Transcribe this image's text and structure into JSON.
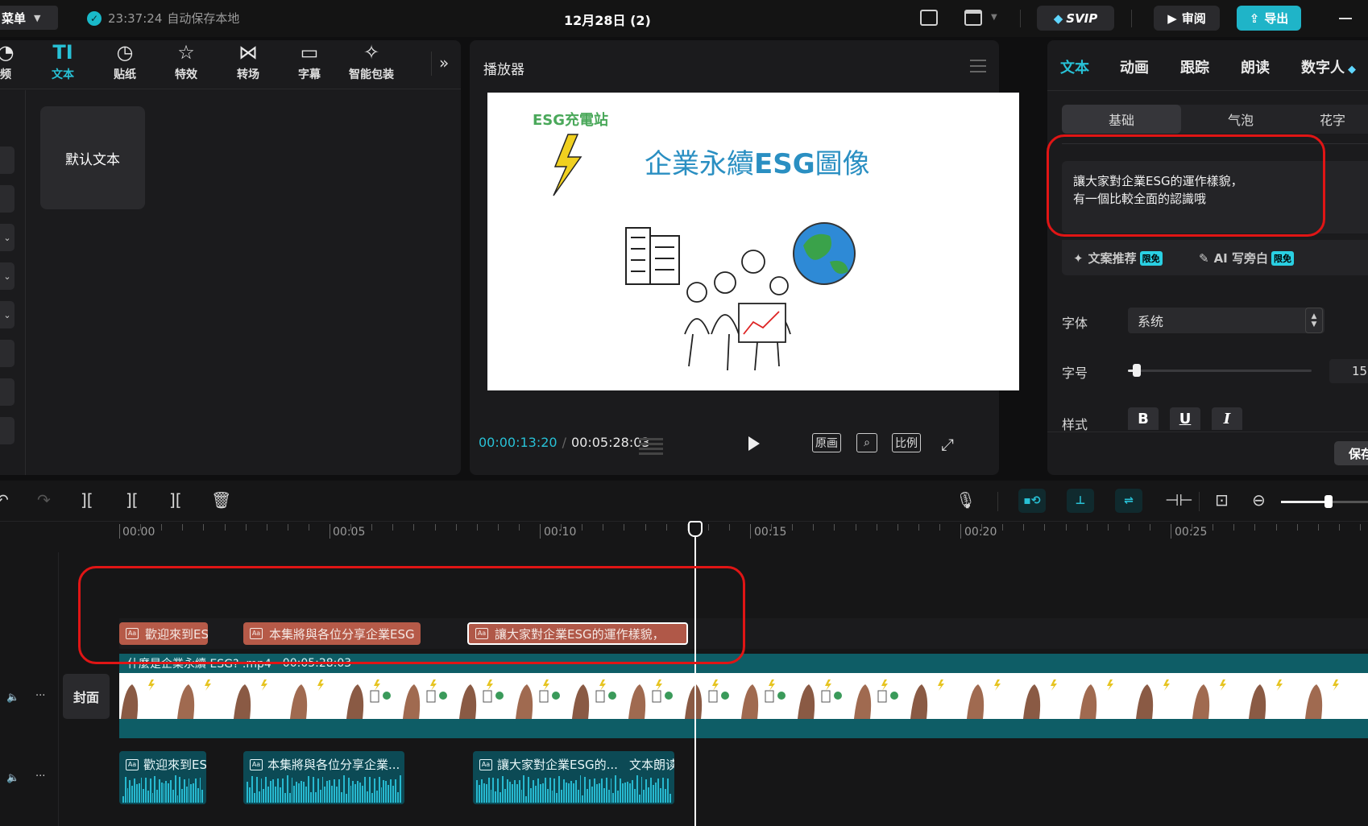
{
  "topbar": {
    "menu_label": "菜单",
    "autosave_time": "23:37:24",
    "autosave_text": "自动保存本地",
    "project_title": "12月28日 (2)",
    "svip_label": "SVIP",
    "review_label": "审阅",
    "export_label": "导出"
  },
  "toolbar": {
    "tools": [
      {
        "label": "频",
        "icon": "media-icon"
      },
      {
        "label": "文本",
        "icon": "text-icon",
        "active": true
      },
      {
        "label": "贴纸",
        "icon": "sticker-icon"
      },
      {
        "label": "特效",
        "icon": "effects-icon"
      },
      {
        "label": "转场",
        "icon": "transition-icon"
      },
      {
        "label": "字幕",
        "icon": "caption-icon"
      },
      {
        "label": "智能包装",
        "icon": "smart-pack-icon"
      }
    ],
    "more_icon": "»"
  },
  "left": {
    "default_text_card": "默认文本"
  },
  "player": {
    "title": "播放器",
    "current_time": "00:00:13:20",
    "total_time": "00:05:28:03",
    "btn_original": "原画",
    "btn_ratio": "比例",
    "video": {
      "logo_text": "ESG充電站",
      "headline_prefix": "企業永續",
      "headline_esg": "ESG",
      "headline_suffix": "圖像"
    }
  },
  "right": {
    "tabs": [
      "文本",
      "动画",
      "跟踪",
      "朗读",
      "数字人"
    ],
    "subtabs": [
      "基础",
      "气泡",
      "花字"
    ],
    "text_value": "讓大家對企業ESG的運作樣貌，\n有一個比較全面的認識哦",
    "ai_copy_label": "文案推荐",
    "ai_narration_label": "AI 写旁白",
    "limited_free_badge": "限免",
    "font_label": "字体",
    "font_value": "系统",
    "size_label": "字号",
    "size_value": "15",
    "size_fraction": 0.05,
    "style_label": "样式",
    "style_bold": "B",
    "style_underline": "U",
    "style_italic": "I",
    "save_label": "保存预设"
  },
  "timeline": {
    "ruler_labels": [
      "00:00",
      "00:05",
      "00:10",
      "00:15",
      "00:20",
      "00:25"
    ],
    "text_clips": [
      "歡迎來到ES",
      "本集將與各位分享企業ESG",
      "讓大家對企業ESG的運作樣貌，"
    ],
    "video_clip_title": "什麼是企業永續 ESG? .mp4",
    "video_clip_duration": "00:05:28:03",
    "cover_label": "封面",
    "audio_clips": [
      "歡迎來到ES",
      "本集將與各位分享企業...",
      "讓大家對企業ESG的..."
    ],
    "audio_extra_label": "文本朗读",
    "zoom_fraction": 0.55
  },
  "colors": {
    "accent": "#28c1d6",
    "text_clip": "#b65a48",
    "video_track": "#0e5d66",
    "highlight": "#e01515"
  }
}
